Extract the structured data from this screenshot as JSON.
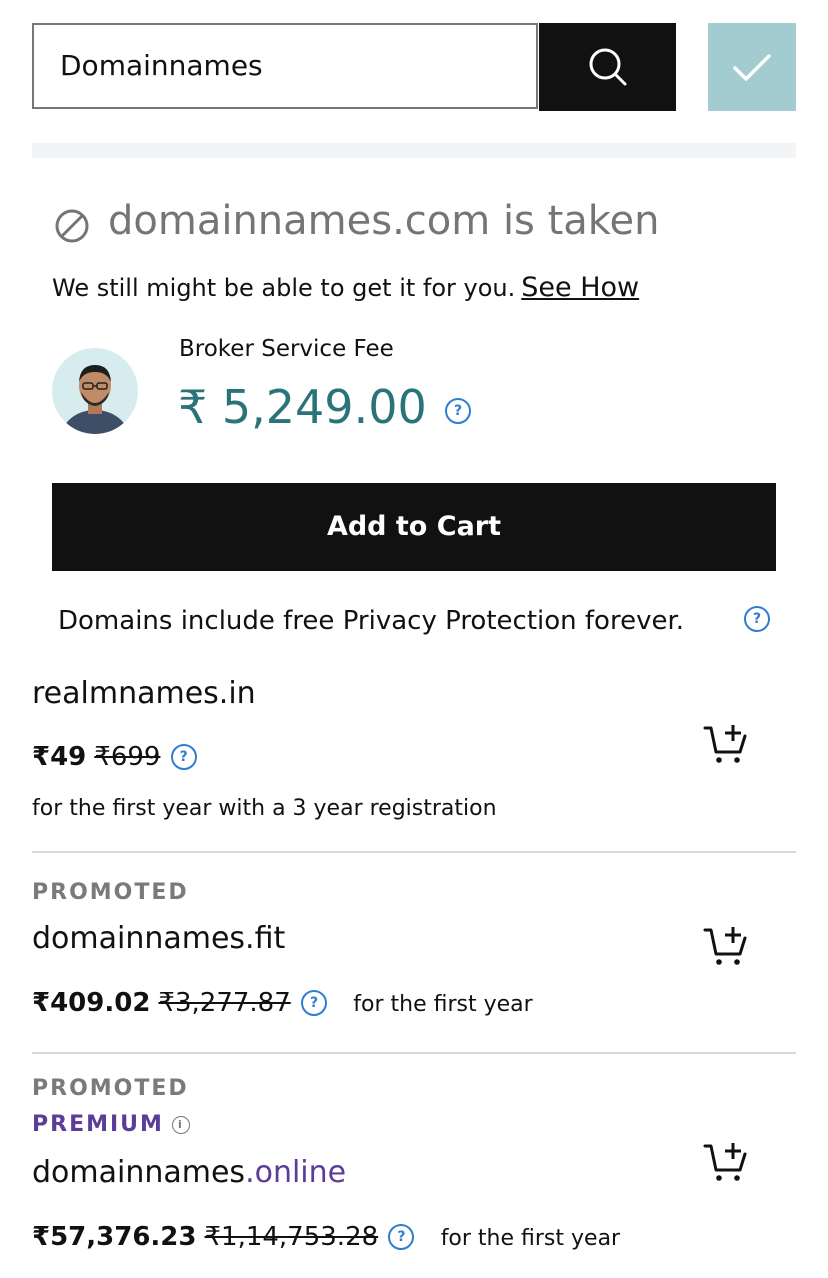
{
  "search": {
    "value": "Domainnames",
    "button_icon": "search-icon",
    "confirm_icon": "check-icon"
  },
  "result": {
    "status_icon": "prohibited-icon",
    "title": "domainnames.com is taken",
    "subtitle": "We still might be able to get it for you.",
    "see_how": "See How",
    "broker_label": "Broker Service Fee",
    "broker_price": "₹ 5,249.00",
    "add_to_cart": "Add to Cart"
  },
  "privacy_note": "Domains include free Privacy Protection forever.",
  "listings": [
    {
      "name": "realmnames.in",
      "price": "₹49",
      "old_price": "₹699",
      "term": "for the first year with a 3 year registration"
    },
    {
      "tag": "PROMOTED",
      "name": "domainnames.fit",
      "price": "₹409.02",
      "old_price": "₹3,277.87",
      "term": "for the first year"
    },
    {
      "tag": "PROMOTED",
      "premium": "PREMIUM",
      "name_base": "domainnames",
      "name_tld": ".online",
      "price": "₹57,376.23",
      "old_price": "₹1,14,753.28",
      "term": "for the first year"
    }
  ],
  "colors": {
    "accent_teal": "#2a7479",
    "premium_purple": "#5b3c98",
    "confirm_bg": "#a3ccd0",
    "help_blue": "#2f7dd1"
  }
}
